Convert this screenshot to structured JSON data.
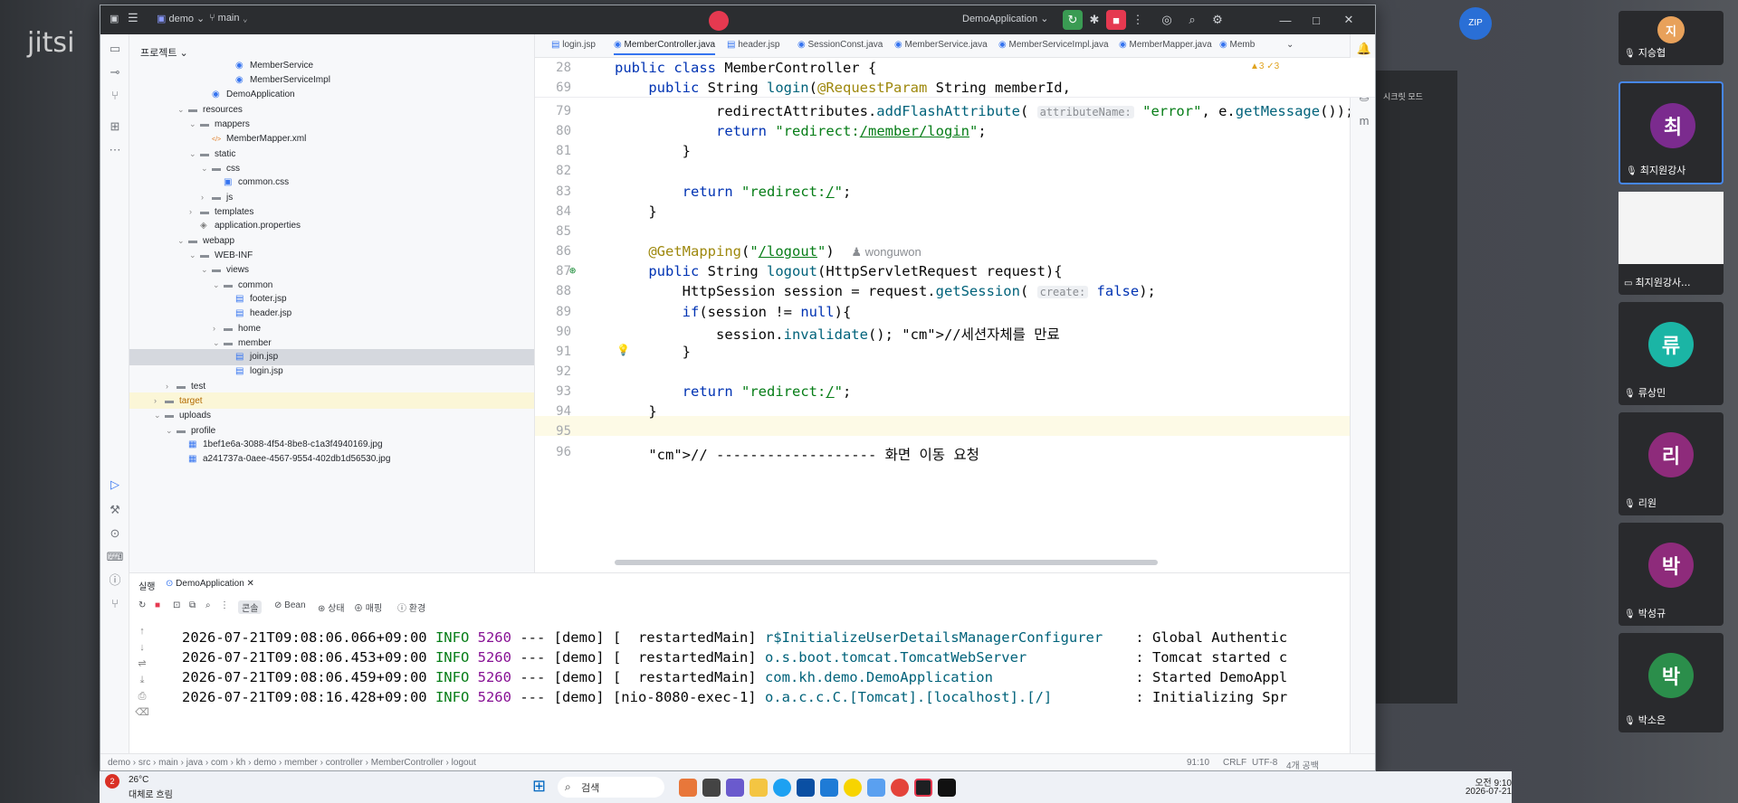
{
  "jitsi": {
    "logo": "jitsi"
  },
  "titlebar": {
    "project_menu": "demo",
    "branch": "main",
    "run_config": "DemoApplication"
  },
  "project_panel": {
    "title": "프로젝트",
    "tree": [
      {
        "label": "MemberService",
        "type": "java",
        "depth": 7
      },
      {
        "label": "MemberServiceImpl",
        "type": "java",
        "depth": 7
      },
      {
        "label": "DemoApplication",
        "type": "java",
        "depth": 5
      },
      {
        "label": "resources",
        "type": "folder",
        "depth": 3,
        "open": true
      },
      {
        "label": "mappers",
        "type": "folder",
        "depth": 4,
        "open": true
      },
      {
        "label": "MemberMapper.xml",
        "type": "xml",
        "depth": 5
      },
      {
        "label": "static",
        "type": "folder",
        "depth": 4,
        "open": true
      },
      {
        "label": "css",
        "type": "folder",
        "depth": 5,
        "open": true
      },
      {
        "label": "common.css",
        "type": "css",
        "depth": 6
      },
      {
        "label": "js",
        "type": "folder",
        "depth": 5,
        "open": false
      },
      {
        "label": "templates",
        "type": "folder",
        "depth": 4
      },
      {
        "label": "application.properties",
        "type": "prop",
        "depth": 4
      },
      {
        "label": "webapp",
        "type": "folder",
        "depth": 3,
        "open": true
      },
      {
        "label": "WEB-INF",
        "type": "folder",
        "depth": 4,
        "open": true
      },
      {
        "label": "views",
        "type": "folder",
        "depth": 5,
        "open": true
      },
      {
        "label": "common",
        "type": "folder",
        "depth": 6,
        "open": true
      },
      {
        "label": "footer.jsp",
        "type": "jsp",
        "depth": 7
      },
      {
        "label": "header.jsp",
        "type": "jsp",
        "depth": 7
      },
      {
        "label": "home",
        "type": "folder",
        "depth": 6,
        "open": false
      },
      {
        "label": "member",
        "type": "folder",
        "depth": 6,
        "open": true
      },
      {
        "label": "join.jsp",
        "type": "jsp",
        "depth": 7,
        "selected": true
      },
      {
        "label": "login.jsp",
        "type": "jsp",
        "depth": 7
      },
      {
        "label": "test",
        "type": "folder",
        "depth": 2,
        "open": false
      },
      {
        "label": "target",
        "type": "folder",
        "depth": 1,
        "open": false,
        "excluded": true
      },
      {
        "label": "uploads",
        "type": "folder",
        "depth": 1,
        "open": true
      },
      {
        "label": "profile",
        "type": "folder",
        "depth": 2,
        "open": true
      },
      {
        "label": "1bef1e6a-3088-4f54-8be8-c1a3f4940169.jpg",
        "type": "img",
        "depth": 3
      },
      {
        "label": "a241737a-0aee-4567-9554-402db1d56530.jpg",
        "type": "img",
        "depth": 3
      }
    ]
  },
  "editor_tabs": [
    {
      "label": "login.jsp",
      "active": false
    },
    {
      "label": "MemberController.java",
      "active": true
    },
    {
      "label": "header.jsp",
      "active": false
    },
    {
      "label": "SessionConst.java",
      "active": false
    },
    {
      "label": "MemberService.java",
      "active": false
    },
    {
      "label": "MemberServiceImpl.java",
      "active": false
    },
    {
      "label": "MemberMapper.java",
      "active": false
    },
    {
      "label": "Memb",
      "active": false
    }
  ],
  "editor": {
    "problems": "▲3  ✓3",
    "sticky": [
      {
        "ln": "28",
        "text": "public class MemberController {"
      },
      {
        "ln": "69",
        "text": "    public String login(@RequestParam String memberId,"
      }
    ],
    "lines": [
      {
        "ln": "79",
        "text": "            redirectAttributes.addFlashAttribute( attributeName: \"error\", e.getMessage());"
      },
      {
        "ln": "80",
        "text": "            return \"redirect:/member/login\";"
      },
      {
        "ln": "81",
        "text": "        }"
      },
      {
        "ln": "82",
        "text": ""
      },
      {
        "ln": "83",
        "text": "        return \"redirect:/\";"
      },
      {
        "ln": "84",
        "text": "    }"
      },
      {
        "ln": "85",
        "text": ""
      },
      {
        "ln": "86",
        "text": "    @GetMapping(\"/logout\")  wonguwon"
      },
      {
        "ln": "87",
        "text": "    public String logout(HttpServletRequest request){"
      },
      {
        "ln": "88",
        "text": "        HttpSession session = request.getSession( create: false);"
      },
      {
        "ln": "89",
        "text": "        if(session != null){"
      },
      {
        "ln": "90",
        "text": "            session.invalidate(); //세션자체를 만료"
      },
      {
        "ln": "91",
        "text": "        }"
      },
      {
        "ln": "92",
        "text": ""
      },
      {
        "ln": "93",
        "text": "        return \"redirect:/\";"
      },
      {
        "ln": "94",
        "text": "    }"
      },
      {
        "ln": "95",
        "text": ""
      },
      {
        "ln": "96",
        "text": "    // ------------------- 화면 이동 요청"
      }
    ],
    "author": "wonguwon",
    "comment_text": "//세션자체를 만료",
    "section_comment": "// ------------------- 화면 이동 요청"
  },
  "run_panel": {
    "title": "실행",
    "config_tab": "DemoApplication",
    "tabs": [
      "콘솔",
      "Bean",
      "상태",
      "매핑",
      "환경"
    ],
    "console_lines": [
      {
        "ts": "2026-07-21T09:08:06.066+09:00",
        "level": "INFO",
        "pid": "5260",
        "thread": "--- [demo] [  restartedMain]",
        "logger": "r$InitializeUserDetailsManagerConfigurer",
        "msg": ": Global Authentic"
      },
      {
        "ts": "2026-07-21T09:08:06.453+09:00",
        "level": "INFO",
        "pid": "5260",
        "thread": "--- [demo] [  restartedMain]",
        "logger": "o.s.boot.tomcat.TomcatWebServer",
        "msg": ": Tomcat started c"
      },
      {
        "ts": "2026-07-21T09:08:06.459+09:00",
        "level": "INFO",
        "pid": "5260",
        "thread": "--- [demo] [  restartedMain]",
        "logger": "com.kh.demo.DemoApplication",
        "msg": ": Started DemoAppl"
      },
      {
        "ts": "2026-07-21T09:08:16.428+09:00",
        "level": "INFO",
        "pid": "5260",
        "thread": "--- [demo] [nio-8080-exec-1]",
        "logger": "o.a.c.c.C.[Tomcat].[localhost].[/]",
        "msg": ": Initializing Spr"
      }
    ]
  },
  "statusbar": {
    "breadcrumb": [
      "demo",
      "src",
      "main",
      "java",
      "com",
      "kh",
      "demo",
      "member",
      "controller",
      "MemberController",
      "logout"
    ],
    "position": "91:10",
    "line_sep": "CRLF",
    "encoding": "UTF-8",
    "indent": "4개 공백"
  },
  "taskbar": {
    "weather_temp": "26°C",
    "weather_desc": "대체로 흐림",
    "search": "검색",
    "time": "오전 9:10",
    "date": "2026-07-21",
    "badge": "2"
  },
  "participants": [
    {
      "initial": "지",
      "name": "지승협",
      "color": "#e8a15a"
    },
    {
      "initial": "최",
      "name": "최지원강사",
      "color": "#7b2b8e"
    },
    {
      "initial": "",
      "name": "최지원강사...",
      "color": "",
      "screen": true
    },
    {
      "initial": "류",
      "name": "류상민",
      "color": "#1bb5a5"
    },
    {
      "initial": "리",
      "name": "리원",
      "color": "#8e2b7b"
    },
    {
      "initial": "박",
      "name": "박성규",
      "color": "#8e2b7b"
    },
    {
      "initial": "박",
      "name": "박소은",
      "color": "#2b8e4b"
    }
  ],
  "side_window": {
    "label": "시크릿 모드"
  },
  "colors": {
    "ide_dark": "#2b2d30",
    "accent": "#3574f0",
    "keyword": "#0033b3",
    "string": "#067d17",
    "annotation": "#9e880d"
  }
}
